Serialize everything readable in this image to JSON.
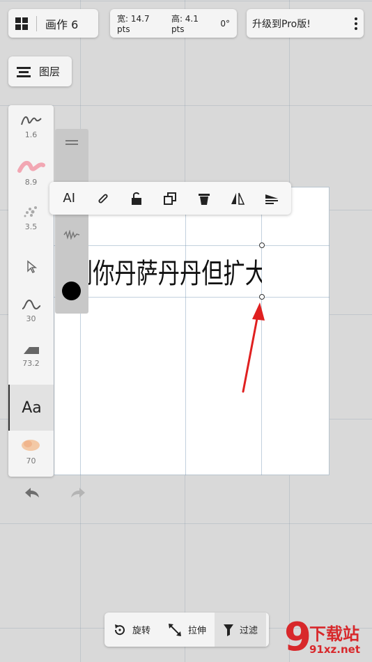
{
  "header": {
    "title": "画作 6",
    "width_label": "宽: 14.7 pts",
    "height_label": "高: 4.1 pts",
    "angle_label": "0°",
    "upgrade_label": "升级到Pro版!"
  },
  "layers": {
    "label": "图层"
  },
  "tools": [
    {
      "name": "pencil",
      "value": "1.6"
    },
    {
      "name": "marker",
      "value": "8.9"
    },
    {
      "name": "spray",
      "value": "3.5"
    },
    {
      "name": "select",
      "value": ""
    },
    {
      "name": "curve",
      "value": "30"
    },
    {
      "name": "eraser",
      "value": "73.2"
    },
    {
      "name": "text",
      "value": "Aa"
    },
    {
      "name": "smudge",
      "value": "70"
    }
  ],
  "context_toolbar": {
    "text_tool_label": "AI"
  },
  "canvas_text": "到你丹萨丹丹但扩大撒啊",
  "bottom_bar": {
    "rotate": "旋转",
    "stretch": "拉伸",
    "filter": "过滤"
  },
  "watermark": {
    "mark": "9",
    "name": "下载站",
    "url": "91xz.net"
  },
  "colors": {
    "accent_arrow": "#e02020",
    "current_color": "#000000",
    "marker_color": "#f2a7b3"
  }
}
